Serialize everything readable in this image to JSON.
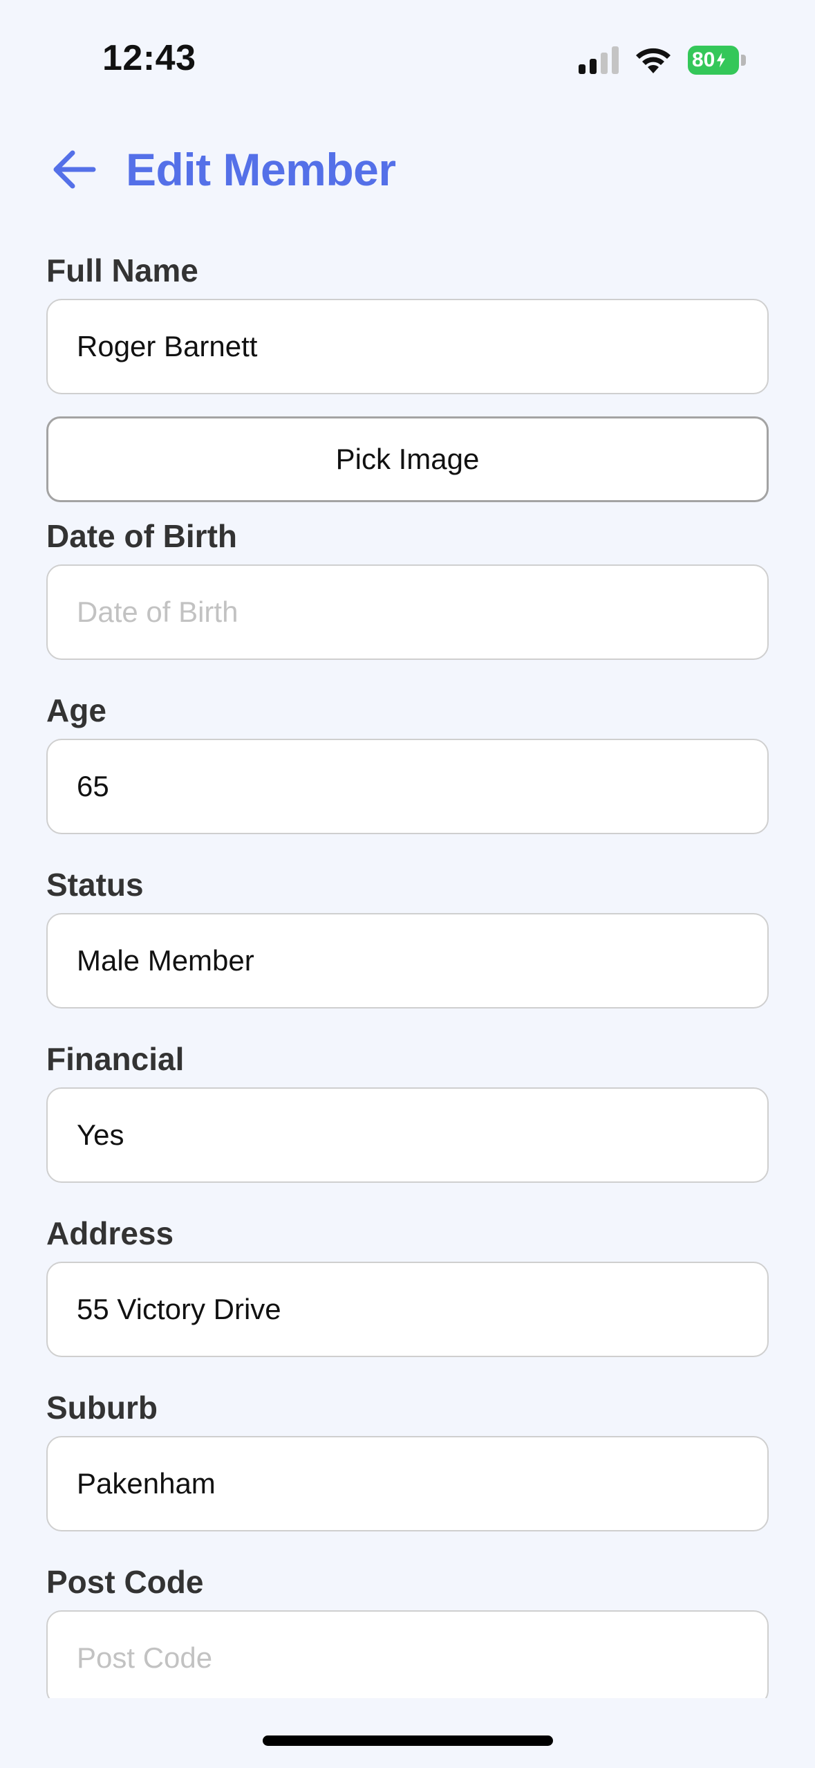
{
  "status_bar": {
    "time": "12:43",
    "battery_level": "80",
    "icons": [
      "signal-icon",
      "wifi-icon",
      "battery-icon"
    ]
  },
  "header": {
    "title": "Edit Member",
    "back_icon": "arrow-left-icon",
    "accent_color": "#5470e8"
  },
  "form": {
    "full_name": {
      "label": "Full Name",
      "value": "Roger Barnett",
      "placeholder": ""
    },
    "pick_image_label": "Pick Image",
    "date_of_birth": {
      "label": "Date of Birth",
      "value": "",
      "placeholder": "Date of Birth"
    },
    "age": {
      "label": "Age",
      "value": "65",
      "placeholder": ""
    },
    "status": {
      "label": "Status",
      "value": "Male Member",
      "placeholder": ""
    },
    "financial": {
      "label": "Financial",
      "value": "Yes",
      "placeholder": ""
    },
    "address": {
      "label": "Address",
      "value": "55 Victory Drive",
      "placeholder": ""
    },
    "suburb": {
      "label": "Suburb",
      "value": "Pakenham",
      "placeholder": ""
    },
    "post_code": {
      "label": "Post Code",
      "value": "",
      "placeholder": "Post Code"
    }
  }
}
